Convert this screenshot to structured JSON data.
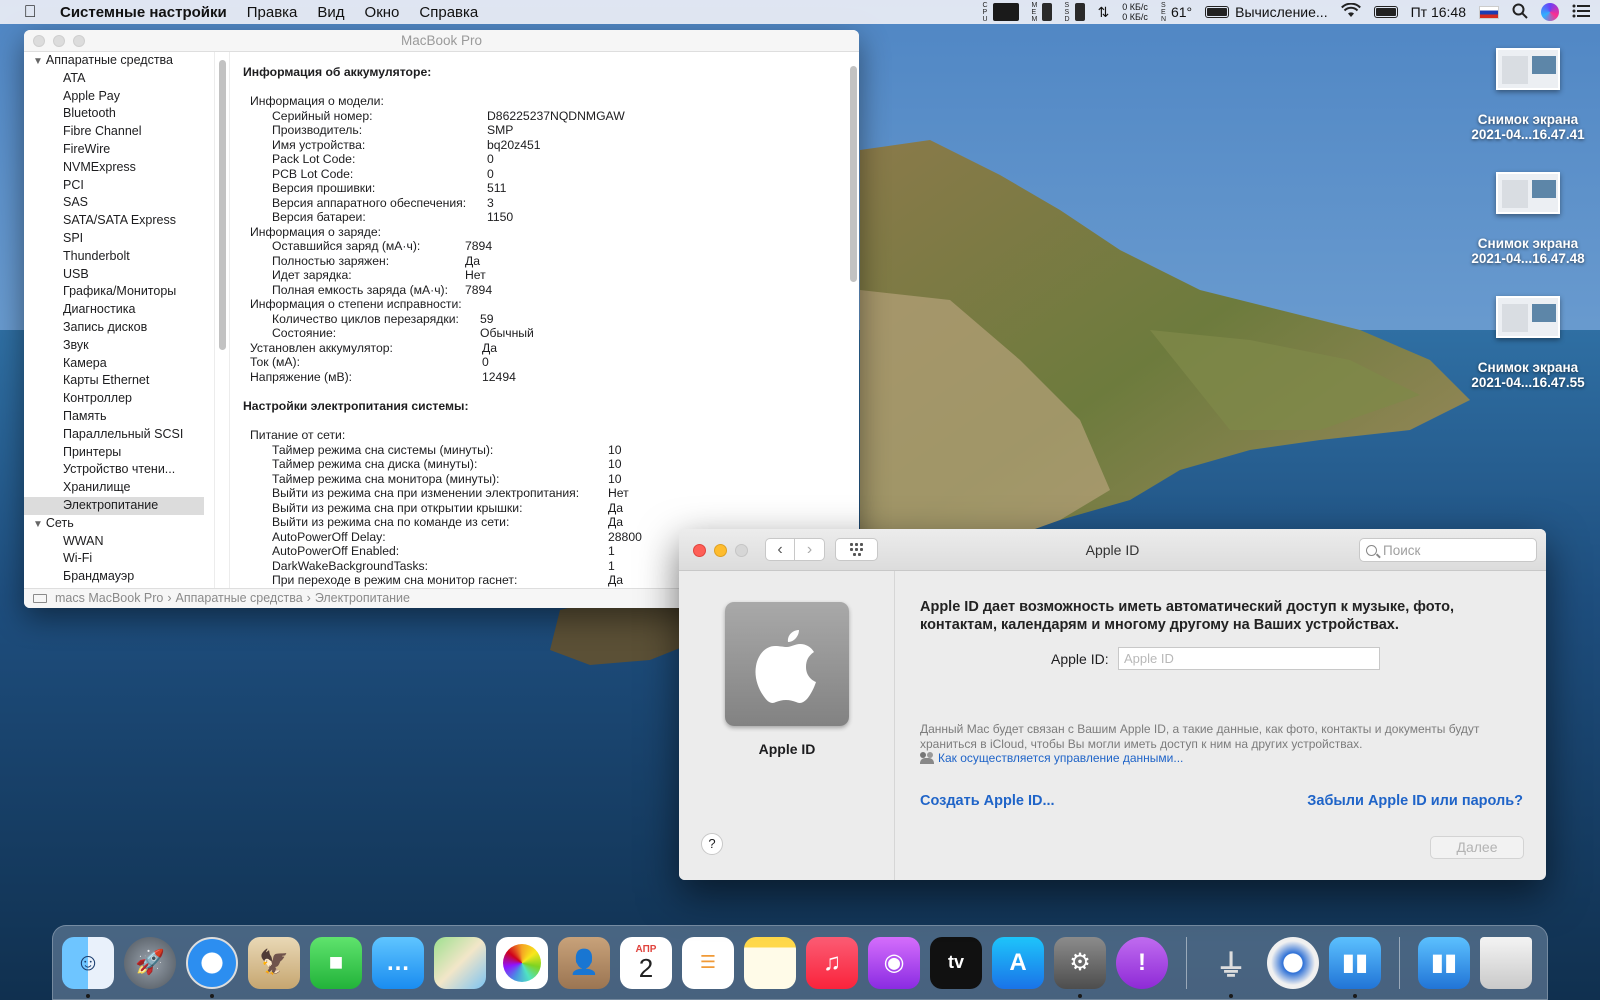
{
  "menubar": {
    "app_name": "Системные настройки",
    "menus": [
      "Правка",
      "Вид",
      "Окно",
      "Справка"
    ],
    "meters": [
      "CPU",
      "MEM",
      "SSD"
    ],
    "net_up": "0 КБ/с",
    "net_down": "0 КБ/с",
    "sensor_label": "SEN",
    "temperature": "61°",
    "battery_status": "Вычисление...",
    "clock": "Пт 16:48"
  },
  "desktop_icons": [
    {
      "line1": "Снимок экрана",
      "line2": "2021-04...16.47.41"
    },
    {
      "line1": "Снимок экрана",
      "line2": "2021-04...16.47.48"
    },
    {
      "line1": "Снимок экрана",
      "line2": "2021-04...16.47.55"
    }
  ],
  "sysinfo": {
    "title": "MacBook Pro",
    "sidebar": {
      "hardware_group": "Аппаратные средства",
      "hardware_items": [
        "ATA",
        "Apple Pay",
        "Bluetooth",
        "Fibre Channel",
        "FireWire",
        "NVMExpress",
        "PCI",
        "SAS",
        "SATA/SATA Express",
        "SPI",
        "Thunderbolt",
        "USB",
        "Графика/Мониторы",
        "Диагностика",
        "Запись дисков",
        "Звук",
        "Камера",
        "Карты Ethernet",
        "Контроллер",
        "Память",
        "Параллельный SCSI",
        "Принтеры",
        "Устройство чтени...",
        "Хранилище",
        "Электропитание"
      ],
      "selected": "Электропитание",
      "network_group": "Сеть",
      "network_items": [
        "WWAN",
        "Wi-Fi",
        "Брандмауэр"
      ]
    },
    "battery_heading": "Информация об аккумуляторе:",
    "model_info": {
      "label": "Информация о модели:",
      "rows": [
        {
          "k": "Серийный номер:",
          "v": "D86225237NQDNMGAW"
        },
        {
          "k": "Производитель:",
          "v": "SMP"
        },
        {
          "k": "Имя устройства:",
          "v": "bq20z451"
        },
        {
          "k": "Pack Lot Code:",
          "v": "0"
        },
        {
          "k": "PCB Lot Code:",
          "v": "0"
        },
        {
          "k": "Версия прошивки:",
          "v": "511"
        },
        {
          "k": "Версия аппаратного обеспечения:",
          "v": "3"
        },
        {
          "k": "Версия батареи:",
          "v": "1150"
        }
      ]
    },
    "charge_info": {
      "label": "Информация о заряде:",
      "rows": [
        {
          "k": "Оставшийся заряд (мА·ч):",
          "v": "7894"
        },
        {
          "k": "Полностью заряжен:",
          "v": "Да"
        },
        {
          "k": "Идет зарядка:",
          "v": "Нет"
        },
        {
          "k": "Полная емкость заряда (мА·ч):",
          "v": "7894"
        }
      ]
    },
    "health_info": {
      "label": "Информация о степени исправности:",
      "rows": [
        {
          "k": "Количество циклов перезарядки:",
          "v": "59"
        },
        {
          "k": "Состояние:",
          "v": "Обычный"
        }
      ]
    },
    "top_rows": [
      {
        "k": "Установлен аккумулятор:",
        "v": "Да"
      },
      {
        "k": "Ток (мА):",
        "v": "0"
      },
      {
        "k": "Напряжение (мВ):",
        "v": "12494"
      }
    ],
    "power_heading": "Настройки электропитания системы:",
    "ac_power": {
      "label": "Питание от сети:",
      "rows": [
        {
          "k": "Таймер режима сна системы (минуты):",
          "v": "10"
        },
        {
          "k": "Таймер режима сна диска (минуты):",
          "v": "10"
        },
        {
          "k": "Таймер режима сна монитора (минуты):",
          "v": "10"
        },
        {
          "k": "Выйти из режима сна при изменении электропитания:",
          "v": "Нет"
        },
        {
          "k": "Выйти из режима сна при открытии крышки:",
          "v": "Да"
        },
        {
          "k": "Выйти из режима сна по команде из сети:",
          "v": "Да"
        },
        {
          "k": "AutoPowerOff Delay:",
          "v": "28800"
        },
        {
          "k": "AutoPowerOff Enabled:",
          "v": "1"
        },
        {
          "k": "DarkWakeBackgroundTasks:",
          "v": "1"
        },
        {
          "k": "При переходе в режим сна монитор гаснет:",
          "v": "Да"
        }
      ]
    },
    "path": [
      "macs MacBook Pro",
      "Аппаратные средства",
      "Электропитание"
    ]
  },
  "prefs": {
    "title": "Apple ID",
    "search_placeholder": "Поиск",
    "tile_label": "Apple ID",
    "intro": "Apple ID дает возможность иметь автоматический доступ к музыке, фото, контактам, календарям и многому другому на Ваших устройствах.",
    "field_label": "Apple ID:",
    "field_placeholder": "Apple ID",
    "note": "Данный Mac будет связан с Вашим Apple ID, а такие данные, как фото, контакты и документы будут храниться в iCloud, чтобы Вы могли иметь доступ к ним на других устройствах.",
    "data_link": "Как осуществляется управление данными...",
    "create_link": "Создать Apple ID...",
    "forgot_link": "Забыли Apple ID или пароль?",
    "next_label": "Далее",
    "help_label": "?"
  },
  "dock": {
    "calendar_month": "АПР",
    "calendar_day": "2",
    "tv_label": "tv"
  }
}
